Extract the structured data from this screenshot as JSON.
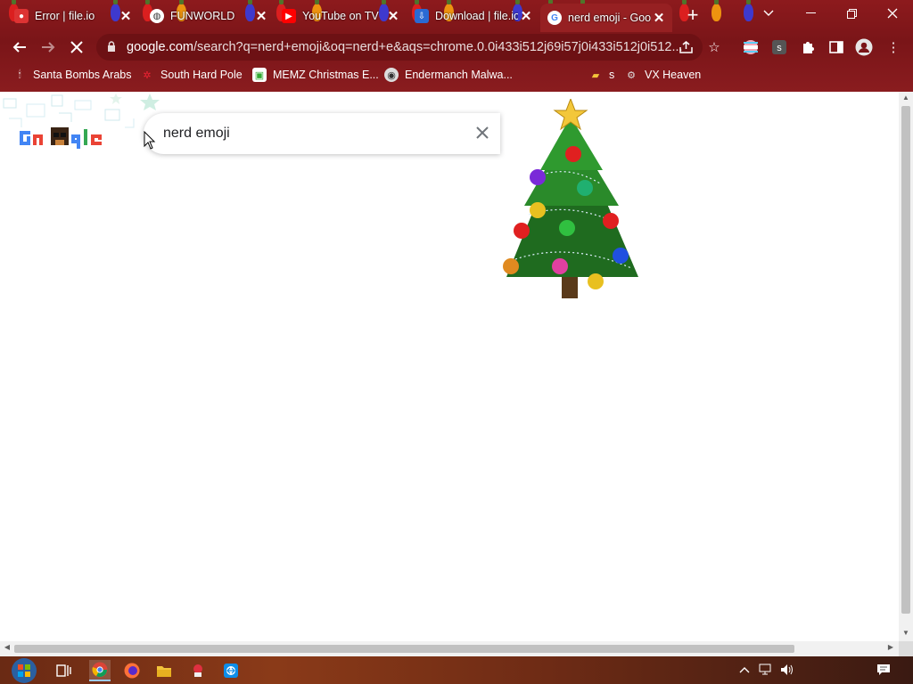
{
  "browser": {
    "tabs": [
      {
        "title": "Error | file.io",
        "favicon": "red-circle-icon"
      },
      {
        "title": "FUNWORLD",
        "favicon": "globe-icon"
      },
      {
        "title": "YouTube on TV",
        "favicon": "youtube-icon"
      },
      {
        "title": "Download | file.io",
        "favicon": "fileio-icon"
      },
      {
        "title": "nerd emoji - Google Search",
        "favicon": "google-icon",
        "active": true
      }
    ],
    "new_tab_symbol": "+",
    "omnibox": {
      "host": "google.com",
      "path": "/search?q=nerd+emoji&oq=nerd+e&aqs=chrome.0.0i433i512j69i57j0i433i512j0i512..."
    },
    "bookmarks": [
      {
        "label": "Santa Bombs Arabs",
        "icon": "bomb-icon"
      },
      {
        "label": "South Hard Pole",
        "icon": "snowflake-icon"
      },
      {
        "label": "MEMZ Christmas E...",
        "icon": "image-icon"
      },
      {
        "label": "Endermanch Malwa...",
        "icon": "wolf-icon"
      },
      {
        "label": "s",
        "icon": "folder-icon"
      },
      {
        "label": "VX Heaven",
        "icon": "vx-icon"
      }
    ]
  },
  "page": {
    "logo_text": "Google",
    "search_query": "nerd emoji"
  },
  "colors": {
    "chrome_bg": "#7a1518",
    "active_tab": "#962022",
    "omnibox_bg": "#6d1114",
    "google_blue": "#4285f4",
    "google_red": "#ea4335",
    "google_yellow": "#fbbc05",
    "google_green": "#34a853"
  }
}
